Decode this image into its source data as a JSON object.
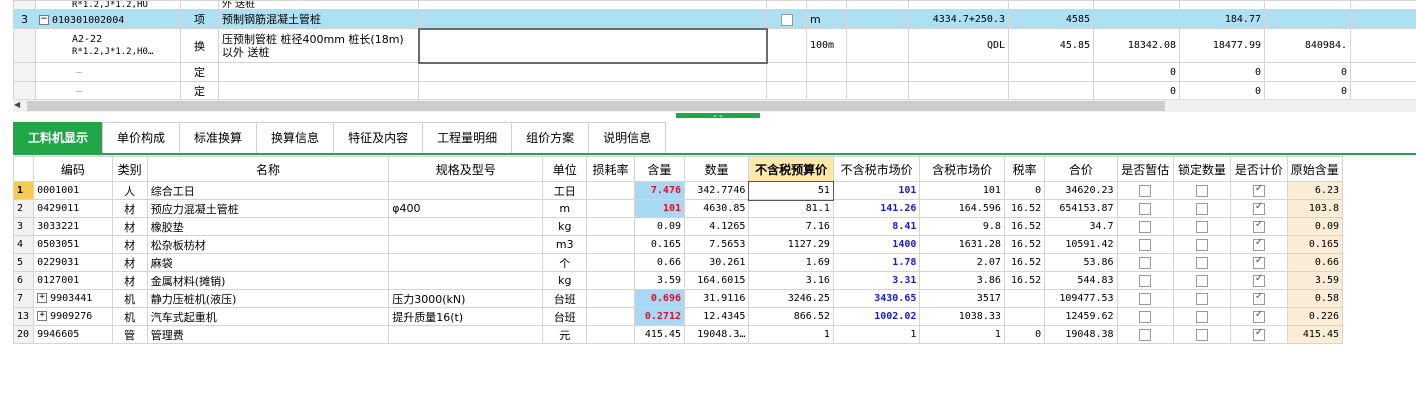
{
  "top_grid": {
    "partial_row": {
      "note": "R*1.2,J*1.2,HU",
      "name_tail": "外  送桩"
    },
    "rows": [
      {
        "no": "3",
        "code": "010301002004",
        "type": "项",
        "name": "预制钢筋混凝土管桩",
        "unit": "m",
        "qty_expr": "4334.7+250.3",
        "qty": "4585",
        "price": "184.77",
        "selected": true
      },
      {
        "code_line1": "A2-22",
        "code_line2": "R*1.2,J*1.2,H0…",
        "type": "换",
        "name": "压预制管桩 桩径400mm 桩长(18m)以外  送桩",
        "unit": "100m",
        "qty_expr": "QDL",
        "qty": "45.85",
        "c1": "18342.08",
        "c2": "18477.99",
        "c3": "840984."
      },
      {
        "code": "—",
        "type": "定",
        "c1": "0",
        "c2": "0",
        "c3": "0"
      },
      {
        "code": "—",
        "type": "定",
        "c1": "0",
        "c2": "0",
        "c3": "0"
      }
    ]
  },
  "tabs": [
    "工料机显示",
    "单价构成",
    "标准换算",
    "换算信息",
    "特征及内容",
    "工程量明细",
    "组价方案",
    "说明信息"
  ],
  "columns": [
    "编码",
    "类别",
    "名称",
    "规格及型号",
    "单位",
    "损耗率",
    "含量",
    "数量",
    "不含税预算价",
    "不含税市场价",
    "含税市场价",
    "税率",
    "合价",
    "是否暂估",
    "锁定数量",
    "是否计价",
    "原始含量"
  ],
  "materials": [
    {
      "no": "1",
      "code": "0001001",
      "cat": "人",
      "name": "综合工日",
      "spec": "",
      "unit": "工日",
      "loss": "",
      "content": "7.476",
      "qty": "342.7746",
      "budget": "51",
      "market": "101",
      "market_tax": "101",
      "tax": "0",
      "total": "34620.23",
      "est": false,
      "lock": false,
      "priced": true,
      "orig": "6.23",
      "content_hl": true,
      "current": true,
      "expand": false
    },
    {
      "no": "2",
      "code": "0429011",
      "cat": "材",
      "name": "预应力混凝土管桩",
      "spec": "φ400",
      "unit": "m",
      "loss": "",
      "content": "101",
      "qty": "4630.85",
      "budget": "81.1",
      "market": "141.26",
      "market_tax": "164.596",
      "tax": "16.52",
      "total": "654153.87",
      "est": false,
      "lock": false,
      "priced": true,
      "orig": "103.8",
      "content_hl": true,
      "expand": false
    },
    {
      "no": "3",
      "code": "3033221",
      "cat": "材",
      "name": "橡胶垫",
      "spec": "",
      "unit": "kg",
      "loss": "",
      "content": "0.09",
      "qty": "4.1265",
      "budget": "7.16",
      "market": "8.41",
      "market_tax": "9.8",
      "tax": "16.52",
      "total": "34.7",
      "est": false,
      "lock": false,
      "priced": true,
      "orig": "0.09",
      "expand": false
    },
    {
      "no": "4",
      "code": "0503051",
      "cat": "材",
      "name": "松杂板枋材",
      "spec": "",
      "unit": "m3",
      "loss": "",
      "content": "0.165",
      "qty": "7.5653",
      "budget": "1127.29",
      "market": "1400",
      "market_tax": "1631.28",
      "tax": "16.52",
      "total": "10591.42",
      "est": false,
      "lock": false,
      "priced": true,
      "orig": "0.165",
      "expand": false
    },
    {
      "no": "5",
      "code": "0229031",
      "cat": "材",
      "name": "麻袋",
      "spec": "",
      "unit": "个",
      "loss": "",
      "content": "0.66",
      "qty": "30.261",
      "budget": "1.69",
      "market": "1.78",
      "market_tax": "2.07",
      "tax": "16.52",
      "total": "53.86",
      "est": false,
      "lock": false,
      "priced": true,
      "orig": "0.66",
      "expand": false
    },
    {
      "no": "6",
      "code": "0127001",
      "cat": "材",
      "name": "金属材料(摊销)",
      "spec": "",
      "unit": "kg",
      "loss": "",
      "content": "3.59",
      "qty": "164.6015",
      "budget": "3.16",
      "market": "3.31",
      "market_tax": "3.86",
      "tax": "16.52",
      "total": "544.83",
      "est": false,
      "lock": false,
      "priced": true,
      "orig": "3.59",
      "expand": false
    },
    {
      "no": "7",
      "code": "9903441",
      "cat": "机",
      "name": "静力压桩机(液压)",
      "spec": "压力3000(kN)",
      "unit": "台班",
      "loss": "",
      "content": "0.696",
      "qty": "31.9116",
      "budget": "3246.25",
      "market": "3430.65",
      "market_tax": "3517",
      "tax": "",
      "total": "109477.53",
      "est": false,
      "lock": false,
      "priced": true,
      "orig": "0.58",
      "content_hl": true,
      "expand": true
    },
    {
      "no": "13",
      "code": "9909276",
      "cat": "机",
      "name": "汽车式起重机",
      "spec": "提升质量16(t)",
      "unit": "台班",
      "loss": "",
      "content": "0.2712",
      "qty": "12.4345",
      "budget": "866.52",
      "market": "1002.02",
      "market_tax": "1038.33",
      "tax": "",
      "total": "12459.62",
      "est": false,
      "lock": false,
      "priced": true,
      "orig": "0.226",
      "content_hl": true,
      "expand": true
    },
    {
      "no": "20",
      "code": "9946605",
      "cat": "管",
      "name": "管理费",
      "spec": "",
      "unit": "元",
      "loss": "",
      "content": "415.45",
      "qty": "19048.3…",
      "budget": "1",
      "market": "1",
      "market_tax": "1",
      "tax": "0",
      "total": "19048.38",
      "est": false,
      "lock": false,
      "priced": true,
      "orig": "415.45",
      "expand": false
    }
  ],
  "colors": {
    "accent": "#22a64a",
    "selected_row": "#aee0f4",
    "content_highlight": "#a8d8f4",
    "budget_header": "#ffe9a8",
    "red_value": "#e0102b",
    "blue_value": "#1a1ad8"
  }
}
